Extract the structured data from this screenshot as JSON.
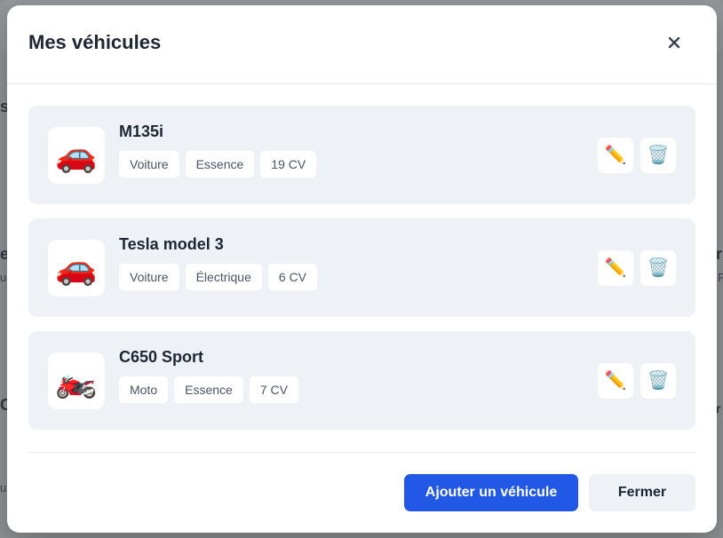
{
  "modal": {
    "title": "Mes véhicules",
    "close_icon": "close-icon"
  },
  "vehicles": [
    {
      "name": "M135i",
      "icon": "🚗",
      "icon_name": "car-icon",
      "tags": [
        "Voiture",
        "Essence",
        "19 CV"
      ]
    },
    {
      "name": "Tesla model 3",
      "icon": "🚗",
      "icon_name": "car-icon",
      "tags": [
        "Voiture",
        "Électrique",
        "6 CV"
      ]
    },
    {
      "name": "C650 Sport",
      "icon": "🏍️",
      "icon_name": "motorcycle-icon",
      "tags": [
        "Moto",
        "Essence",
        "7 CV"
      ]
    }
  ],
  "actions": {
    "edit_icon": "✏️",
    "delete_icon": "🗑️"
  },
  "footer": {
    "add_label": "Ajouter un véhicule",
    "close_label": "Fermer"
  },
  "colors": {
    "primary": "#2159e6",
    "card_bg": "#eef1f6",
    "text_dark": "#1f2633"
  }
}
